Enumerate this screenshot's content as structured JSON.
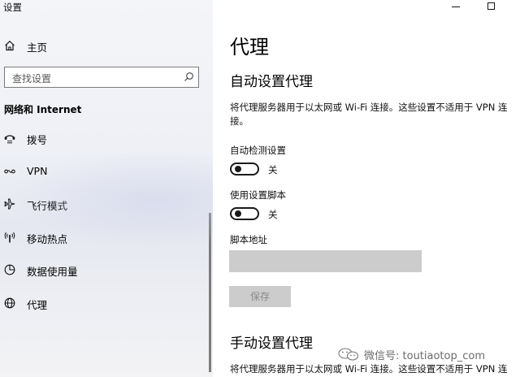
{
  "app": {
    "title": "设置"
  },
  "sidebar": {
    "home_label": "主页",
    "search_placeholder": "查找设置",
    "section_title": "网络和 Internet",
    "items": [
      {
        "label": "拨号",
        "icon": "dialup-icon"
      },
      {
        "label": "VPN",
        "icon": "vpn-icon"
      },
      {
        "label": "飞行模式",
        "icon": "airplane-icon"
      },
      {
        "label": "移动热点",
        "icon": "hotspot-icon"
      },
      {
        "label": "数据使用量",
        "icon": "data-usage-icon"
      },
      {
        "label": "代理",
        "icon": "proxy-globe-icon"
      }
    ]
  },
  "window_controls": {
    "minimize": "minimize-icon",
    "maximize": "maximize-icon"
  },
  "main": {
    "page_title": "代理",
    "auto_section": {
      "heading": "自动设置代理",
      "description": "将代理服务器用于以太网或 Wi-Fi 连接。这些设置不适用于 VPN 连接。",
      "auto_detect": {
        "label": "自动检测设置",
        "state": "关"
      },
      "use_script": {
        "label": "使用设置脚本",
        "state": "关"
      },
      "script_address": {
        "label": "脚本地址",
        "value": ""
      },
      "save_label": "保存"
    },
    "manual_section": {
      "heading": "手动设置代理",
      "description": "将代理服务器用于以太网或 Wi-Fi 连接。这些设置不适用于 VPN 连接。"
    }
  },
  "watermark": {
    "text": "微信号: toutiaotop_com"
  },
  "colors": {
    "sidebar_bg": "#eceef4",
    "toggle_off": "#1a1a1a",
    "disabled_bg": "#cccccc"
  }
}
